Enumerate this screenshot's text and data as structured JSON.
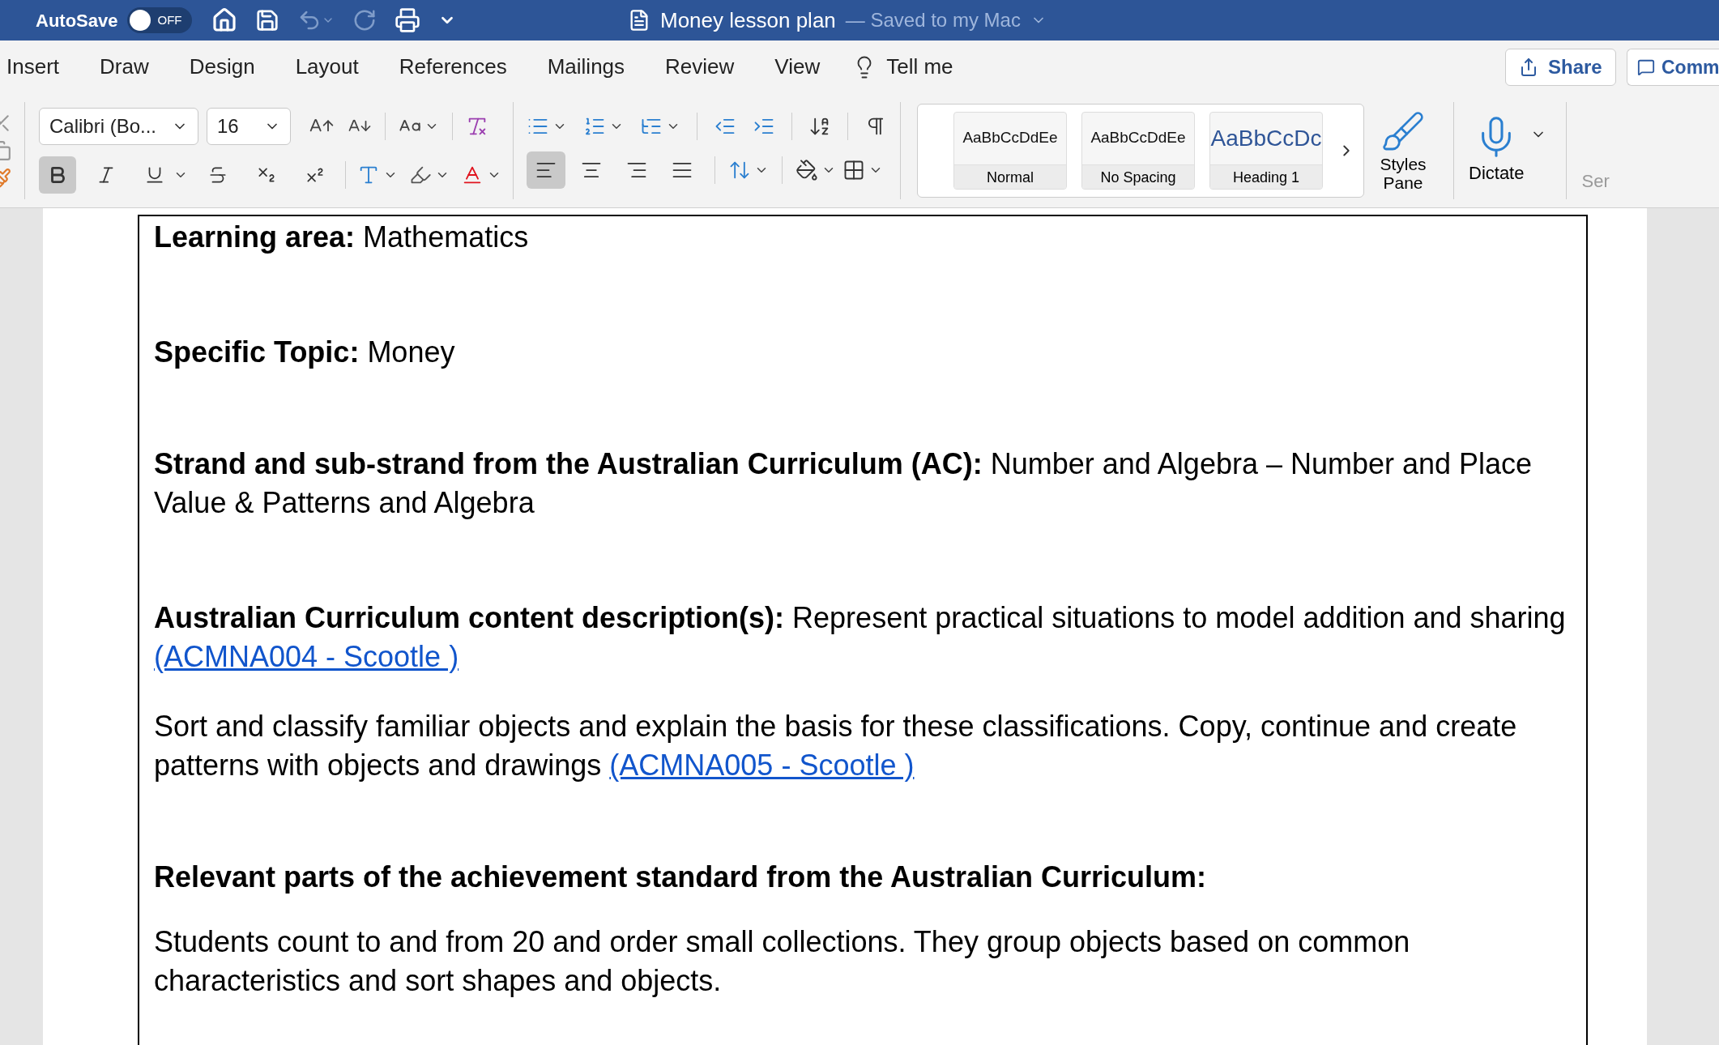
{
  "title_bar": {
    "autosave_label": "AutoSave",
    "autosave_toggle": {
      "label": "OFF",
      "on": false
    },
    "document_title": "Money lesson plan",
    "save_status": "— Saved to my Mac"
  },
  "menu_tabs": [
    {
      "label": "Insert"
    },
    {
      "label": "Draw"
    },
    {
      "label": "Design"
    },
    {
      "label": "Layout"
    },
    {
      "label": "References"
    },
    {
      "label": "Mailings"
    },
    {
      "label": "Review"
    },
    {
      "label": "View"
    },
    {
      "label": "Tell me",
      "kind": "search"
    }
  ],
  "share_button": "Share",
  "comments_button": "Comm",
  "ribbon": {
    "font_name": "Calibri (Bo...",
    "font_size": "16",
    "format_buttons": [
      {
        "kind": "bold",
        "selected": true
      },
      {
        "kind": "italic",
        "selected": false
      },
      {
        "kind": "underline",
        "selected": false
      },
      {
        "kind": "strike",
        "selected": false
      },
      {
        "kind": "subscript",
        "selected": false
      },
      {
        "kind": "superscript",
        "selected": false
      }
    ],
    "align_buttons": [
      {
        "kind": "left",
        "selected": true
      },
      {
        "kind": "center",
        "selected": false
      },
      {
        "kind": "right",
        "selected": false
      },
      {
        "kind": "justify",
        "selected": false
      }
    ],
    "styles": [
      {
        "preview": "AaBbCcDdEe",
        "name": "Normal",
        "kind": "body"
      },
      {
        "preview": "AaBbCcDdEe",
        "name": "No Spacing",
        "kind": "body"
      },
      {
        "preview": "AaBbCcDc",
        "name": "Heading 1",
        "kind": "heading"
      }
    ],
    "styles_pane": "Styles Pane",
    "dictate": "Dictate",
    "cut_button": "Ser"
  },
  "document": {
    "paragraphs": [
      {
        "text": "**Learning area:**  Mathematics"
      },
      {
        "text": "**Specific Topic:** Money"
      },
      {
        "text": "**Strand and sub-strand from the Australian Curriculum (AC):** Number and Algebra – Number and Place Value & Patterns and Algebra"
      },
      {
        "text": "**Australian Curriculum content description(s):** Represent practical situations to model addition and sharing",
        "link": "(ACMNA004 - Scootle )"
      },
      {
        "text": "Sort and classify familiar objects and explain the basis for these classifications. Copy, continue and create patterns with objects and drawings",
        "link": "(ACMNA005 - Scootle )"
      },
      {
        "text": "Relevant parts of the achievement standard from the Australian Curriculum:",
        "kind": "heading"
      },
      {
        "text": "Students count to and from 20 and order small collections. They group objects based on common characteristics and sort shapes and objects."
      }
    ]
  }
}
